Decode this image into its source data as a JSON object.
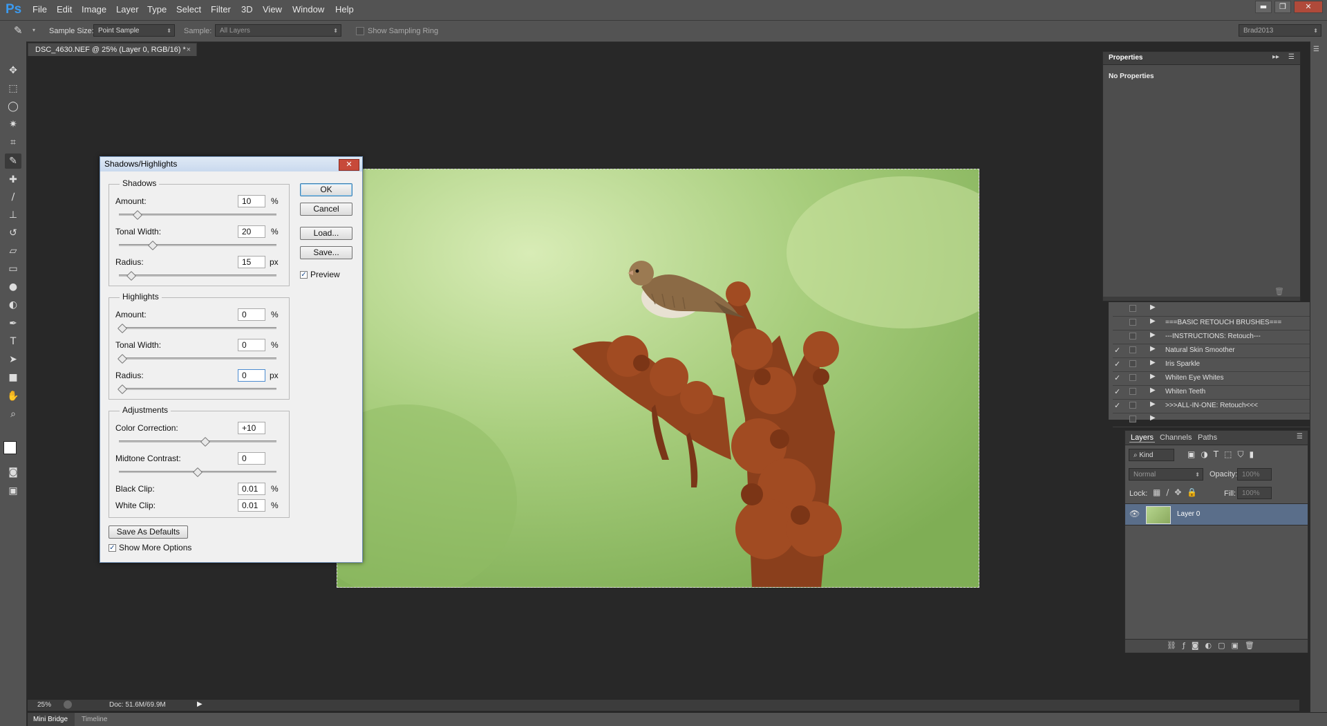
{
  "app": {
    "logo": "Ps"
  },
  "menu": [
    "File",
    "Edit",
    "Image",
    "Layer",
    "Type",
    "Select",
    "Filter",
    "3D",
    "View",
    "Window",
    "Help"
  ],
  "window_controls": {
    "minimize": "▬",
    "restore": "❐",
    "close": "✕"
  },
  "options_bar": {
    "sample_size_label": "Sample Size:",
    "sample_size_value": "Point Sample",
    "sample_label": "Sample:",
    "sample_value": "All Layers",
    "sampling_ring_label": "Show Sampling Ring",
    "workspace": "Brad2013"
  },
  "document": {
    "tab_title": "DSC_4630.NEF @ 25% (Layer 0, RGB/16) *",
    "close": "×"
  },
  "dialog": {
    "title": "Shadows/Highlights",
    "close": "✕",
    "shadows": {
      "title": "Shadows",
      "amount_label": "Amount:",
      "amount": "10",
      "amount_unit": "%",
      "amount_pos": 0.1,
      "tonal_label": "Tonal Width:",
      "tonal": "20",
      "tonal_unit": "%",
      "tonal_pos": 0.2,
      "radius_label": "Radius:",
      "radius": "15",
      "radius_unit": "px",
      "radius_pos": 0.06
    },
    "highlights": {
      "title": "Highlights",
      "amount_label": "Amount:",
      "amount": "0",
      "amount_unit": "%",
      "amount_pos": 0.0,
      "tonal_label": "Tonal Width:",
      "tonal": "0",
      "tonal_unit": "%",
      "tonal_pos": 0.0,
      "radius_label": "Radius:",
      "radius": "0",
      "radius_unit": "px",
      "radius_pos": 0.0
    },
    "adjustments": {
      "title": "Adjustments",
      "color_label": "Color Correction:",
      "color": "+10",
      "color_pos": 0.55,
      "midtone_label": "Midtone Contrast:",
      "midtone": "0",
      "midtone_pos": 0.5,
      "black_label": "Black Clip:",
      "black": "0.01",
      "black_unit": "%",
      "white_label": "White Clip:",
      "white": "0.01",
      "white_unit": "%"
    },
    "buttons": {
      "ok": "OK",
      "cancel": "Cancel",
      "load": "Load...",
      "save": "Save..."
    },
    "preview_label": "Preview",
    "save_defaults": "Save As Defaults",
    "show_more": "Show More Options",
    "check": "✓"
  },
  "properties_panel": {
    "tab": "Properties",
    "content": "No Properties"
  },
  "actions": [
    {
      "checked": "",
      "name": ""
    },
    {
      "checked": "",
      "name": "===BASIC RETOUCH BRUSHES==="
    },
    {
      "checked": "",
      "name": "---INSTRUCTIONS: Retouch---"
    },
    {
      "checked": "✓",
      "name": "Natural Skin Smoother"
    },
    {
      "checked": "✓",
      "name": "Iris Sparkle"
    },
    {
      "checked": "✓",
      "name": "Whiten Eye Whites"
    },
    {
      "checked": "✓",
      "name": "Whiten Teeth"
    },
    {
      "checked": "✓",
      "name": ">>>ALL-IN-ONE: Retouch<<<"
    },
    {
      "checked": "",
      "name": ""
    }
  ],
  "layers_panel": {
    "tabs": [
      "Layers",
      "Channels",
      "Paths"
    ],
    "kind": "Kind",
    "blend_mode": "Normal",
    "opacity_label": "Opacity:",
    "opacity": "100%",
    "lock_label": "Lock:",
    "fill_label": "Fill:",
    "fill": "100%",
    "layer_name": "Layer 0"
  },
  "status": {
    "zoom": "25%",
    "doc": "Doc: 51.6M/69.9M"
  },
  "bottom_tabs": [
    "Mini Bridge",
    "Timeline"
  ],
  "colors": {
    "accent": "#3b9af0",
    "panel_bg": "#535353",
    "canvas_bg": "#282828",
    "dialog_bg": "#f0f0f0"
  }
}
